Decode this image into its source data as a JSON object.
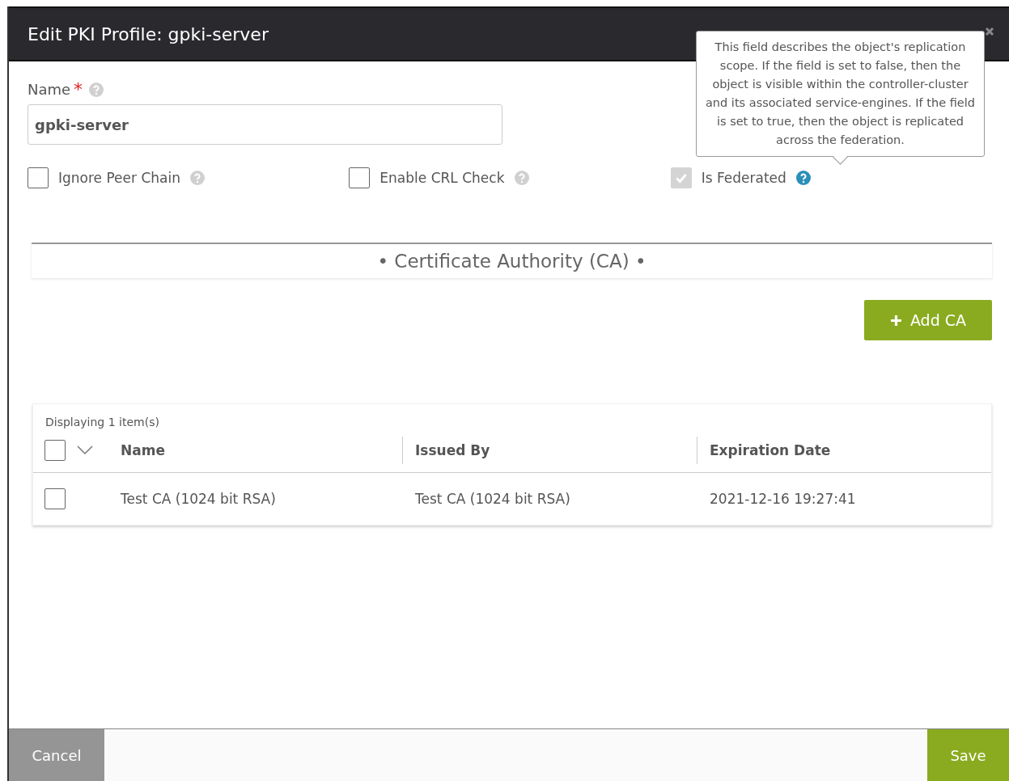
{
  "window": {
    "title": "Edit PKI Profile: gpki-server"
  },
  "name_field": {
    "label": "Name",
    "required_mark": "*",
    "value": "gpki-server"
  },
  "options": [
    {
      "label": "Ignore Peer Chain",
      "checked": false,
      "disabled": false,
      "help_highlighted": false
    },
    {
      "label": "Enable CRL Check",
      "checked": false,
      "disabled": false,
      "help_highlighted": false
    },
    {
      "label": "Is Federated",
      "checked": true,
      "disabled": true,
      "help_highlighted": true
    }
  ],
  "tooltip": {
    "text": "This field describes the object's replication scope. If the field is set to false, then the object is visible within the controller-cluster and its associated service-engines. If the field is set to true, then the object is replicated across the federation."
  },
  "section": {
    "title": "• Certificate Authority (CA) •"
  },
  "add_button": {
    "label": "Add CA"
  },
  "grid": {
    "count": "Displaying 1 item(s)",
    "select_all_checked": false,
    "columns": [
      "Name",
      "Issued By",
      "Expiration Date"
    ],
    "rows": [
      {
        "checked": false,
        "cells": [
          "Test CA (1024 bit RSA)",
          "Test CA (1024 bit RSA)",
          "2021-12-16 19:27:41"
        ]
      }
    ]
  },
  "footer": {
    "cancel": "Cancel",
    "save": "Save"
  }
}
